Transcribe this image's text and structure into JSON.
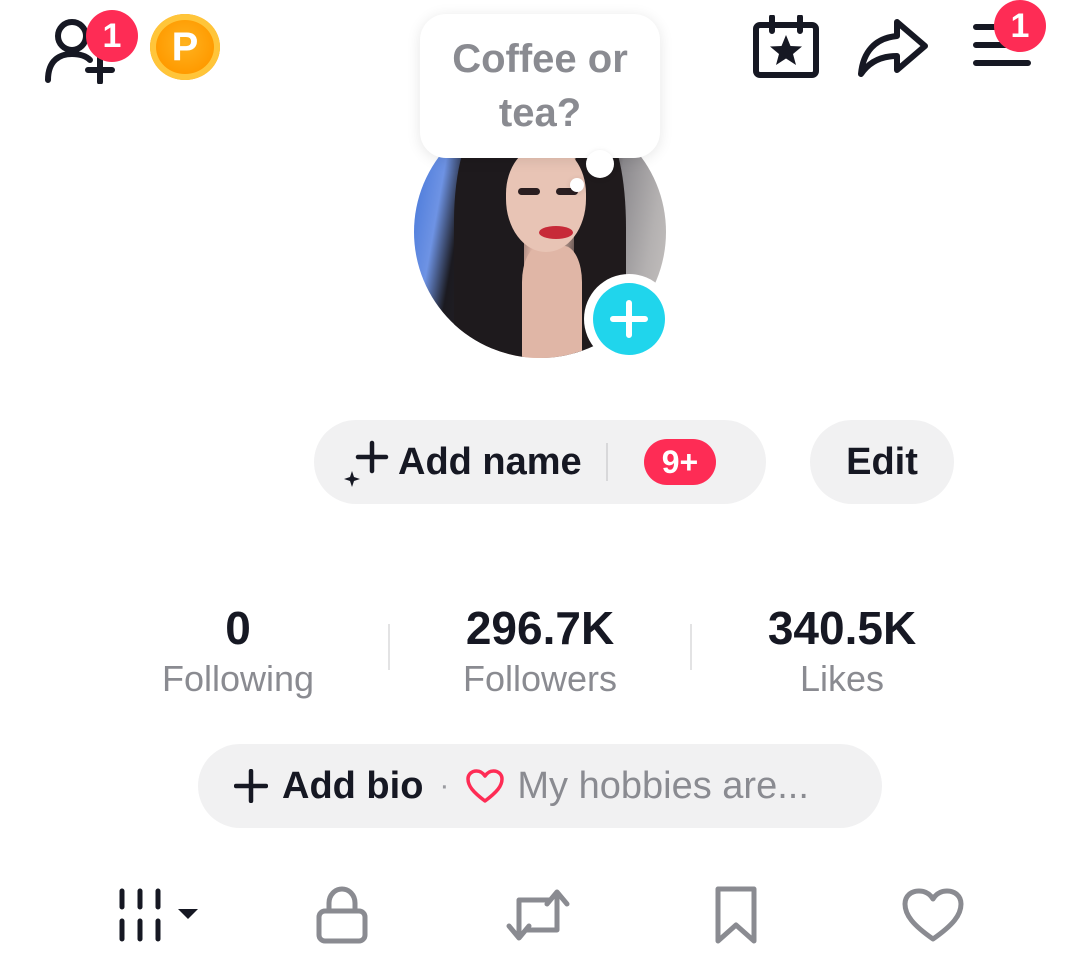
{
  "topbar": {
    "add_friends_badge": "1",
    "coin_letter": "P",
    "menu_badge": "1"
  },
  "bubble": {
    "text": "Coffee or tea?"
  },
  "profile": {
    "add_name_label": "Add name",
    "notification_count": "9+",
    "edit_label": "Edit"
  },
  "stats": [
    {
      "value": "0",
      "label": "Following"
    },
    {
      "value": "296.7K",
      "label": "Followers"
    },
    {
      "value": "340.5K",
      "label": "Likes"
    }
  ],
  "bio": {
    "add_bio_label": "Add bio",
    "separator": "·",
    "hint": "My hobbies are..."
  },
  "tabs": [
    "grid-icon",
    "lock-icon",
    "repost-icon",
    "bookmark-icon",
    "heart-icon"
  ],
  "colors": {
    "accent_red": "#fe2c55",
    "plus_cyan": "#20d5ec",
    "coin_orange": "#ff9a00",
    "text_gray": "#8a8b91",
    "pill_bg": "#f1f1f2"
  }
}
